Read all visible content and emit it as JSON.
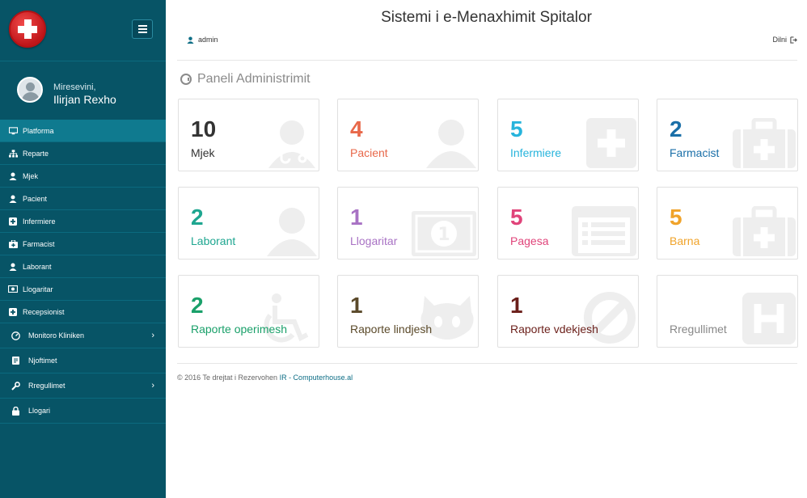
{
  "app": {
    "title": "Sistemi i e-Menaxhimit Spitalor",
    "user": "admin",
    "logout": "Dilni"
  },
  "sidebar": {
    "greeting": "Miresevini,",
    "username": "Ilirjan Rexho",
    "items": [
      {
        "label": "Platforma",
        "icon": "monitor-icon",
        "active": true
      },
      {
        "label": "Reparte",
        "icon": "sitemap-icon"
      },
      {
        "label": "Mjek",
        "icon": "doctor-icon"
      },
      {
        "label": "Pacient",
        "icon": "user-icon"
      },
      {
        "label": "Infermiere",
        "icon": "plus-square-icon"
      },
      {
        "label": "Farmacist",
        "icon": "medkit-icon"
      },
      {
        "label": "Laborant",
        "icon": "user-icon"
      },
      {
        "label": "Llogaritar",
        "icon": "money-icon"
      },
      {
        "label": "Recepsionist",
        "icon": "plus-square-icon"
      },
      {
        "label": "Monitoro Kliniken",
        "icon": "dashboard-icon",
        "chevron": true
      },
      {
        "label": "Njoftimet",
        "icon": "notice-icon"
      },
      {
        "label": "Rregullimet",
        "icon": "wrench-icon",
        "chevron": true
      },
      {
        "label": "Llogari",
        "icon": "lock-icon"
      }
    ]
  },
  "dashboard": {
    "title": "Paneli Administrimit",
    "cards": [
      {
        "value": "10",
        "label": "Mjek",
        "color": "#333333",
        "label_color": "#333333",
        "icon": "user-md-icon"
      },
      {
        "value": "4",
        "label": "Pacient",
        "color": "#e8684a",
        "label_color": "#e8684a",
        "icon": "user-icon"
      },
      {
        "value": "5",
        "label": "Infermiere",
        "color": "#27b4dc",
        "label_color": "#27b4dc",
        "icon": "plus-square-icon"
      },
      {
        "value": "2",
        "label": "Farmacist",
        "color": "#1a6fa8",
        "label_color": "#1a6fa8",
        "icon": "medkit-icon"
      },
      {
        "value": "2",
        "label": "Laborant",
        "color": "#1ea690",
        "label_color": "#1ea690",
        "icon": "user-icon"
      },
      {
        "value": "1",
        "label": "Llogaritar",
        "color": "#a872c4",
        "label_color": "#a872c4",
        "icon": "money-icon"
      },
      {
        "value": "5",
        "label": "Pagesa",
        "color": "#e0447a",
        "label_color": "#e0447a",
        "icon": "list-alt-icon"
      },
      {
        "value": "5",
        "label": "Barna",
        "color": "#f0a32a",
        "label_color": "#f0a32a",
        "icon": "medkit-icon"
      },
      {
        "value": "2",
        "label": "Raporte operimesh",
        "color": "#1aa06a",
        "label_color": "#1aa06a",
        "icon": "wheelchair-icon"
      },
      {
        "value": "1",
        "label": "Raporte lindjesh",
        "color": "#5b4a2a",
        "label_color": "#5b4a2a",
        "icon": "github-icon"
      },
      {
        "value": "1",
        "label": "Raporte vdekjesh",
        "color": "#6b1f1a",
        "label_color": "#6b1f1a",
        "icon": "ban-icon"
      },
      {
        "value": "",
        "label": "Rregullimet",
        "color": "#888888",
        "label_color": "#888888",
        "icon": "h-square-icon"
      }
    ]
  },
  "footer": {
    "text": "© 2016 Te drejtat i Rezervohen",
    "link": "IR - Computerhouse.al"
  }
}
